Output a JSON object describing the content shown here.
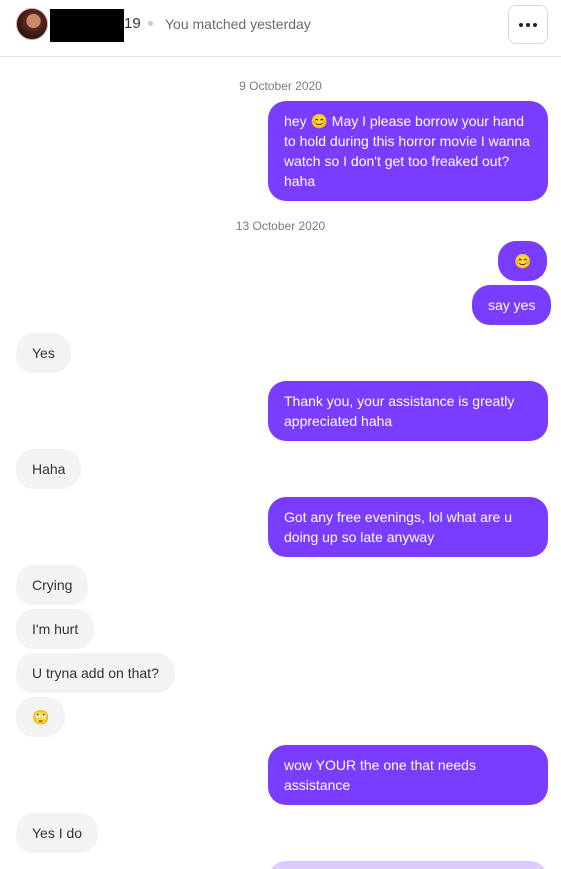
{
  "header": {
    "age": "19",
    "matched_text": "You matched yesterday"
  },
  "dates": [
    "9 October 2020",
    "13 October 2020"
  ],
  "messages": [
    {
      "dir": "out",
      "text": "hey 😊 May I please borrow your hand to hold during this horror movie I wanna watch so I don't get too freaked out? haha"
    },
    {
      "dir": "out",
      "text": "😊"
    },
    {
      "dir": "out",
      "text": "say yes"
    },
    {
      "dir": "in",
      "text": "Yes"
    },
    {
      "dir": "out",
      "text": "Thank you, your assistance is greatly appreciated haha"
    },
    {
      "dir": "in",
      "text": "Haha"
    },
    {
      "dir": "out",
      "text": "Got any free evenings, lol what are u doing up so late anyway"
    },
    {
      "dir": "in",
      "text": "Crying"
    },
    {
      "dir": "in",
      "text": "I'm hurt"
    },
    {
      "dir": "in",
      "text": "U tryna add on that?"
    },
    {
      "dir": "in",
      "text": "🙄"
    },
    {
      "dir": "out",
      "text": "wow YOUR the one that needs assistance"
    },
    {
      "dir": "in",
      "text": "Yes I do"
    }
  ],
  "colors": {
    "outgoing_bubble": "#7a3cff",
    "incoming_bubble": "#f3f3f3"
  },
  "icons": {
    "more_button": "more-horizontal-icon"
  }
}
